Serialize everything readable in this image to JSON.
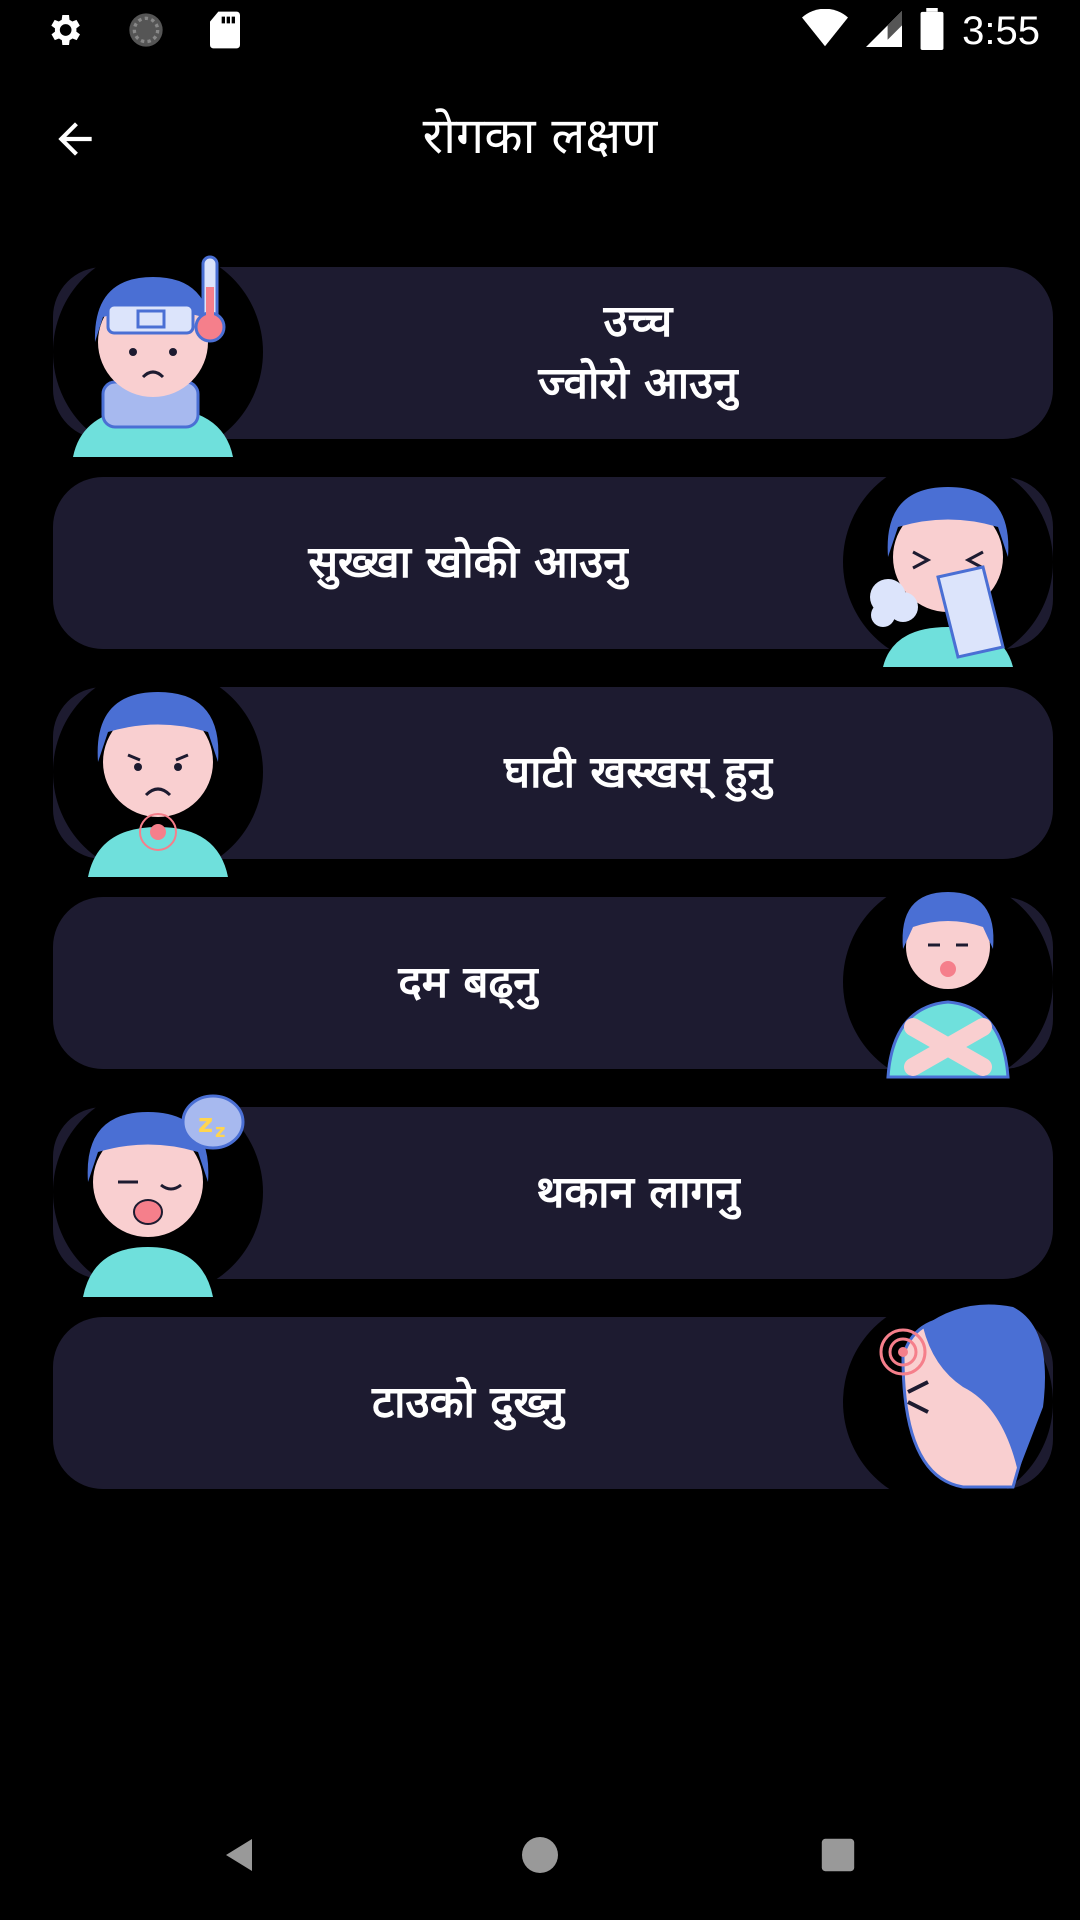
{
  "status_bar": {
    "time": "3:55",
    "icons": [
      "settings-icon",
      "sync-icon",
      "sd-card-icon",
      "wifi-icon",
      "signal-icon",
      "battery-icon"
    ]
  },
  "app_bar": {
    "title": "रोगका लक्षण",
    "back_icon": "arrow-back-icon"
  },
  "symptoms": [
    {
      "label": "उच्च\nज्वोरो आउनु",
      "image": "fever-avatar",
      "side": "left"
    },
    {
      "label": "सुख्खा खोकी आउनु",
      "image": "cough-avatar",
      "side": "right"
    },
    {
      "label": "घाटी खस्खस् हुनु",
      "image": "sore-throat-avatar",
      "side": "left"
    },
    {
      "label": "दम बढ्नु",
      "image": "breathing-avatar",
      "side": "right"
    },
    {
      "label": "थकान लागनु",
      "image": "tired-avatar",
      "side": "left"
    },
    {
      "label": "टाउको दुख्नु",
      "image": "headache-avatar",
      "side": "right"
    }
  ],
  "nav_bar": {
    "icons": [
      "back-triangle-icon",
      "home-circle-icon",
      "recents-square-icon"
    ]
  },
  "colors": {
    "background": "#000000",
    "card": "#1d1b30",
    "hair": "#4a6fd4",
    "skin": "#f9cfd0",
    "shirt": "#6fe0dc"
  }
}
